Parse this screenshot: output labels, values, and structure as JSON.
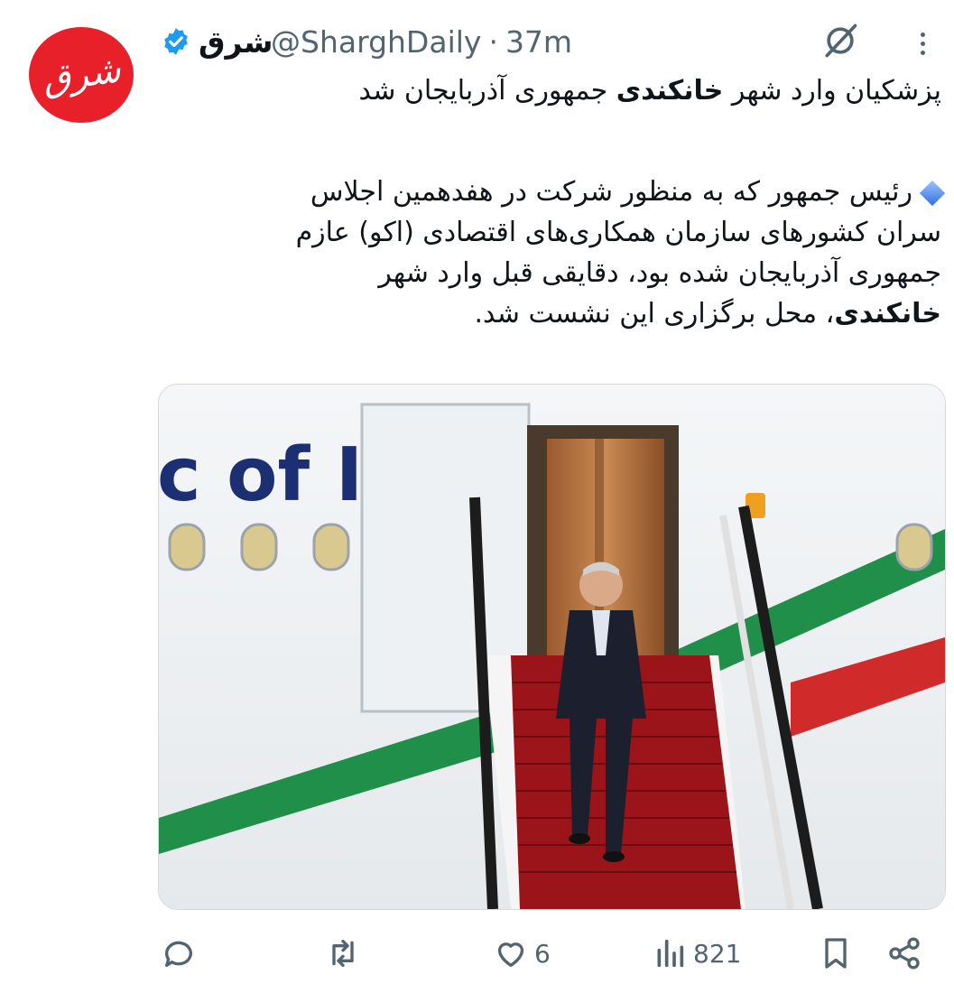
{
  "tweet": {
    "avatar_text": "شرق",
    "display_name": "شرق",
    "handle": "@SharghDaily",
    "separator": "·",
    "time": "37m",
    "line1_pre": "پزشکیان وارد شهر ",
    "line1_bold": "خانکندی",
    "line1_post": " جمهوری آذربایجان شد",
    "para_line1": "رئیس جمهور که به منظور شرکت در هفدهمین اجلاس",
    "para_line2": "سران کشورهای سازمان همکاری‌های اقتصادی (اکو) عازم",
    "para_line3": "جمهوری آذربایجان شده بود، دقایقی قبل وارد شهر",
    "para_line4_bold": "خانکندی",
    "para_line4_rest": "، محل برگزاری این نشست شد.",
    "media_text": "c of I"
  },
  "actions": {
    "reply_count": "",
    "retweet_count": "",
    "like_count": "6",
    "views_count": "821"
  },
  "icons": {
    "verified": "verified-badge-icon",
    "grok": "grok-icon",
    "more": "more-icon",
    "reply": "reply-icon",
    "retweet": "retweet-icon",
    "like": "heart-icon",
    "views": "views-icon",
    "bookmark": "bookmark-icon",
    "share": "share-icon"
  },
  "colors": {
    "brand_red": "#e8202a",
    "verified_blue": "#1d9bf0",
    "muted": "#536471",
    "text": "#0f1419"
  }
}
